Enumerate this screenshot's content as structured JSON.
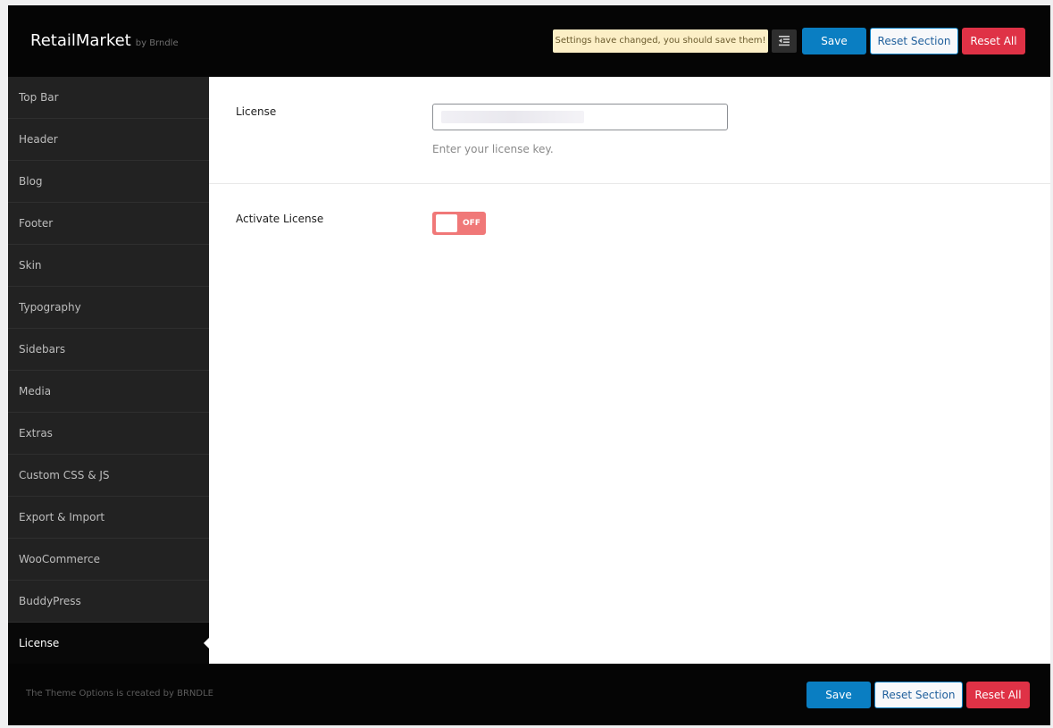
{
  "header": {
    "brand_name": "RetailMarket",
    "brand_by": "by Brndle",
    "notice": "Settings have changed, you should save them!",
    "collapse_icon": "indent-left-icon",
    "save_label": "Save",
    "reset_section_label": "Reset Section",
    "reset_all_label": "Reset All"
  },
  "sidebar": {
    "items": [
      {
        "label": "Top Bar"
      },
      {
        "label": "Header"
      },
      {
        "label": "Blog"
      },
      {
        "label": "Footer"
      },
      {
        "label": "Skin"
      },
      {
        "label": "Typography"
      },
      {
        "label": "Sidebars"
      },
      {
        "label": "Media"
      },
      {
        "label": "Extras"
      },
      {
        "label": "Custom CSS & JS"
      },
      {
        "label": "Export & Import"
      },
      {
        "label": "WooCommerce"
      },
      {
        "label": "BuddyPress"
      },
      {
        "label": "License"
      }
    ],
    "active_item": "License"
  },
  "main": {
    "license": {
      "label": "License",
      "value": "",
      "description": "Enter your license key."
    },
    "activate_license": {
      "label": "Activate License",
      "state": "OFF"
    }
  },
  "footer": {
    "credit": "The Theme Options is created by BRNDLE",
    "save_label": "Save",
    "reset_section_label": "Reset Section",
    "reset_all_label": "Reset All"
  },
  "colors": {
    "accent": "#0a7ec2",
    "danger": "#df3246",
    "toggle_off": "#f07878",
    "header_bg": "#050505",
    "sidebar_bg": "#222222"
  }
}
